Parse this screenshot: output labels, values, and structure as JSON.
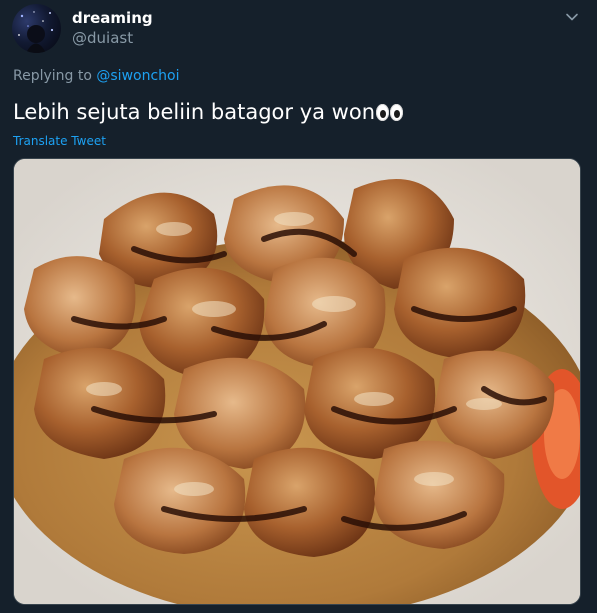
{
  "author": {
    "display_name": "dreaming",
    "handle": "@duiast"
  },
  "reply": {
    "prefix": "Replying to",
    "mention": "@siwonchoi"
  },
  "tweet": {
    "text": "Lebih sejuta beliin batagor ya won",
    "emoji": "eyes",
    "translate_label": "Translate Tweet"
  },
  "icons": {
    "caret": "chevron-down-icon"
  },
  "colors": {
    "background": "#15202b",
    "secondary_text": "#8899a6",
    "link": "#1da1f2",
    "primary_text": "#ffffff"
  }
}
